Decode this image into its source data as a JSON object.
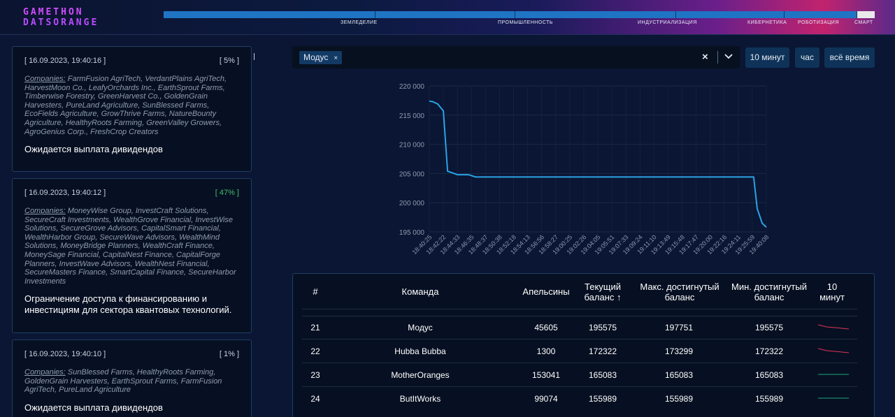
{
  "header": {
    "logo_line1": "GAMETHON",
    "logo_line2": "DATSORANGE",
    "stages": [
      "ЗЕМЛЕДЕЛИЕ",
      "ПРОМЫШЛЕННОСТЬ",
      "ИНДУСТРИАЛИЗАЦИЯ",
      "КИБЕРНЕТИКА",
      "РОБОТИЗАЦИЯ",
      "СМАРТ"
    ]
  },
  "feed": [
    {
      "timestamp": "[ 16.09.2023, 19:40:16 ]",
      "percent": "[ 5% ]",
      "companies_label": "Companies:",
      "companies": "FarmFusion AgriTech, VerdantPlains AgriTech, HarvestMoon Co., LeafyOrchards Inc., EarthSprout Farms, Timberwise Forestry, GreenHarvest Co., GoldenGrain Harvesters, PureLand Agriculture, SunBlessed Farms, EcoFields Agriculture, GrowThrive Farms, NatureBounty Agriculture, HealthyRoots Farming, GreenValley Growers, AgroGenius Corp., FreshCrop Creators",
      "headline": "Ожидается выплата дивидендов"
    },
    {
      "timestamp": "[ 16.09.2023, 19:40:12 ]",
      "percent": "[ 47% ]",
      "companies_label": "Companies:",
      "companies": "MoneyWise Group, InvestCraft Solutions, SecureCraft Investments, WealthGrove Financial, InvestWise Solutions, SecureGrove Advisors, CapitalSmart Financial, WealthHarbor Group, SecureWave Advisors, WealthMind Solutions, MoneyBridge Planners, WealthCraft Finance, MoneySage Financial, CapitalNest Finance, CapitalForge Planners, InvestWave Advisors, WealthNest Financial, SecureMasters Finance, SmartCapital Finance, SecureHarbor Investments",
      "headline": "Ограничение доступа к финансированию и инвестициям для сектора квантовых технологий."
    },
    {
      "timestamp": "[ 16.09.2023, 19:40:10 ]",
      "percent": "[ 1% ]",
      "companies_label": "Companies:",
      "companies": "SunBlessed Farms, HealthyRoots Farming, GoldenGrain Harvesters, EarthSprout Farms, FarmFusion AgriTech, PureLand Agriculture",
      "headline": "Ожидается выплата дивидендов"
    }
  ],
  "filter": {
    "selected_tag": "Модус",
    "tag_remove": "×",
    "clear": "×"
  },
  "time_buttons": [
    "10 минут",
    "час",
    "всё время"
  ],
  "chart_data": {
    "type": "line",
    "title": "",
    "xlabel": "",
    "ylabel": "",
    "ylim": [
      195000,
      220000
    ],
    "y_ticks": [
      "220 000",
      "215 000",
      "210 000",
      "205 000",
      "200 000",
      "195 000"
    ],
    "x_ticks": [
      "18:40:25",
      "18:42:22",
      "18:44:33",
      "18:46:35",
      "18:48:37",
      "18:50:38",
      "18:52:18",
      "18:54:13",
      "18:56:56",
      "18:58:27",
      "19:00:25",
      "19:02:26",
      "19:04:05",
      "19:05:51",
      "19:07:33",
      "19:09:24",
      "19:11:10",
      "19:13:49",
      "19:15:48",
      "19:17:47",
      "19:20:00",
      "19:22:16",
      "19:24:11",
      "19:25:59",
      "19:40:08"
    ],
    "grid": true,
    "color": "#2aa3e6",
    "series": [
      {
        "x": [
          0,
          0.25,
          0.6,
          1.0,
          1.3,
          2.0,
          2.8,
          3.3,
          4,
          6,
          10,
          14,
          18,
          22,
          23.1,
          23.35,
          23.7,
          24
        ],
        "values": [
          217400,
          217300,
          216900,
          215700,
          205400,
          204800,
          204800,
          204400,
          204400,
          204400,
          204400,
          204400,
          204400,
          204400,
          204400,
          199000,
          196500,
          195800
        ]
      }
    ]
  },
  "table": {
    "headers": [
      "#",
      "Команда",
      "Апельсины",
      "Текущий баланс ↑",
      "Макс. достигнутый баланс",
      "Мин. достигнутый баланс",
      "10 минут"
    ],
    "rows": [
      {
        "rank": "21",
        "team": "Модус",
        "oranges": "45605",
        "current": "195575",
        "max": "197751",
        "min": "195575",
        "trend": "down"
      },
      {
        "rank": "22",
        "team": "Hubba Bubba",
        "oranges": "1300",
        "current": "172322",
        "max": "173299",
        "min": "172322",
        "trend": "down"
      },
      {
        "rank": "23",
        "team": "MotherOranges",
        "oranges": "153041",
        "current": "165083",
        "max": "165083",
        "min": "165083",
        "trend": "flat"
      },
      {
        "rank": "24",
        "team": "ButItWorks",
        "oranges": "99074",
        "current": "155989",
        "max": "155989",
        "min": "155989",
        "trend": "flat"
      }
    ],
    "trend_colors": {
      "down": "#e0325a",
      "flat": "#1fa37a"
    }
  }
}
